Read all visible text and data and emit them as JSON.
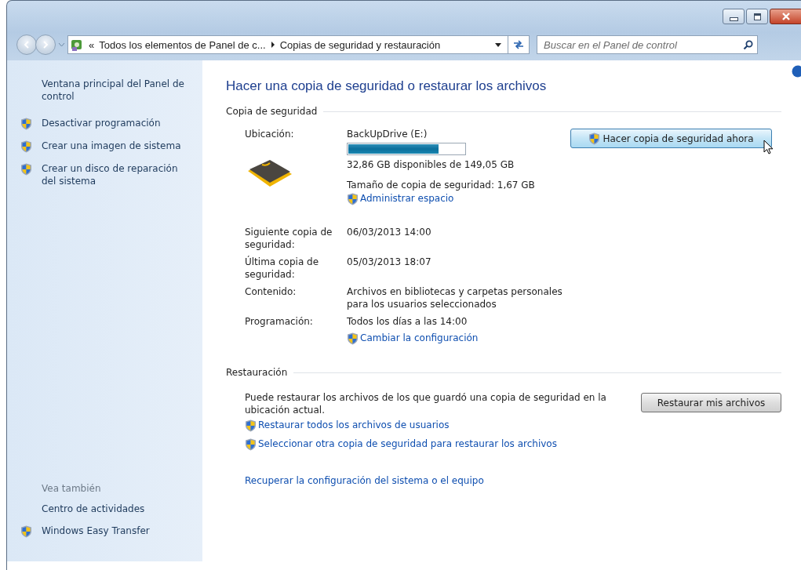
{
  "address_bar": {
    "overflow": "«",
    "crumbs": [
      "Todos los elementos de Panel de c...",
      "Copias de seguridad y restauración"
    ]
  },
  "search": {
    "placeholder": "Buscar en el Panel de control"
  },
  "sidebar": {
    "home_link": "Ventana principal del Panel de control",
    "tasks": [
      {
        "label": "Desactivar programación",
        "shield": true
      },
      {
        "label": "Crear una imagen de sistema",
        "shield": true
      },
      {
        "label": "Crear un disco de reparación del sistema",
        "shield": true
      }
    ],
    "see_also": {
      "heading": "Vea también",
      "items": [
        {
          "label": "Centro de actividades",
          "shield": false
        },
        {
          "label": "Windows Easy Transfer",
          "shield": true
        }
      ]
    }
  },
  "main": {
    "title": "Hacer una copia de seguridad o restaurar los archivos",
    "backup": {
      "heading": "Copia de seguridad",
      "location_label": "Ubicación:",
      "drive_name": "BackUpDrive (E:)",
      "usage": {
        "level": 0.78
      },
      "free_text": "32,86 GB disponibles de 149,05 GB",
      "size_text": "Tamaño de copia de seguridad: 1,67 GB",
      "manage_link": {
        "label": "Administrar espacio",
        "shield": true
      },
      "button": {
        "label": "Hacer copia de seguridad ahora",
        "shield": true
      },
      "details": [
        {
          "label": "Siguiente copia de seguridad:",
          "value": "06/03/2013 14:00"
        },
        {
          "label": "Última copia de seguridad:",
          "value": "05/03/2013 18:07"
        },
        {
          "label": "Contenido:",
          "value": "Archivos en bibliotecas y carpetas personales para los usuarios seleccionados"
        },
        {
          "label": "Programación:",
          "value": "Todos los días a las 14:00"
        }
      ],
      "change_link": {
        "label": "Cambiar la configuración",
        "shield": true
      }
    },
    "restore": {
      "heading": "Restauración",
      "text": "Puede restaurar los archivos de los que guardó una copia de seguridad en la ubicación actual.",
      "button": {
        "label": "Restaurar mis archivos"
      },
      "links": [
        {
          "label": "Restaurar todos los archivos de usuarios",
          "shield": true
        },
        {
          "label": "Seleccionar otra copia de seguridad para restaurar los archivos",
          "shield": true
        }
      ],
      "recover_link": {
        "label": "Recuperar la configuración del sistema o el equipo",
        "shield": false
      }
    }
  }
}
